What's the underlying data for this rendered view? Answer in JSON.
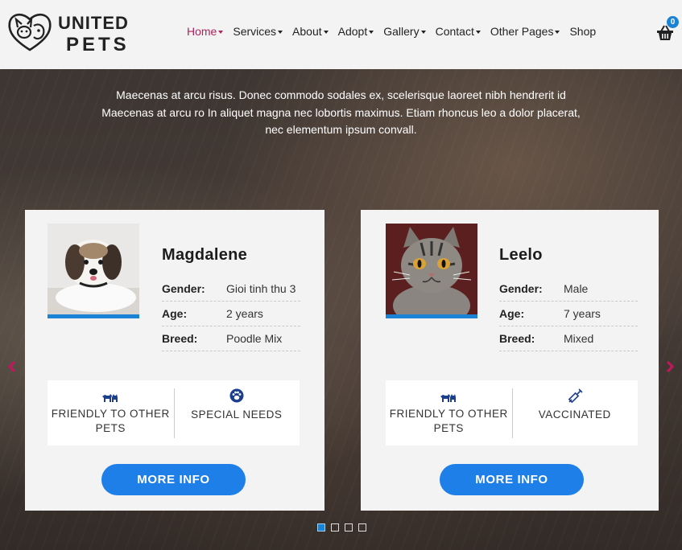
{
  "brand": {
    "line1": "UNITED",
    "line2": "PETS"
  },
  "nav": {
    "items": [
      {
        "label": "Home",
        "dropdown": true,
        "active": true
      },
      {
        "label": "Services",
        "dropdown": true
      },
      {
        "label": "About",
        "dropdown": true
      },
      {
        "label": "Adopt",
        "dropdown": true
      },
      {
        "label": "Gallery",
        "dropdown": true
      },
      {
        "label": "Contact",
        "dropdown": true
      },
      {
        "label": "Other Pages",
        "dropdown": true
      },
      {
        "label": "Shop",
        "dropdown": false
      }
    ],
    "cart_count": "0"
  },
  "hero": {
    "text_line1": "Maecenas at arcu risus. Donec commodo sodales ex, scelerisque laoreet nibh hendrerit id",
    "text_line2": "Maecenas at arcu ro In aliquet magna nec lobortis maximus. Etiam rhoncus leo a dolor placerat,",
    "text_line3": "nec elementum ipsum convall."
  },
  "pets": [
    {
      "name": "Magdalene",
      "gender_label": "Gender:",
      "gender": "Gioi tinh thu 3",
      "age_label": "Age:",
      "age": "2 years",
      "breed_label": "Breed:",
      "breed": "Poodle Mix",
      "feature1": "Friendly to other pets",
      "feature2": "Special needs",
      "button": "MORE INFO"
    },
    {
      "name": "Leelo",
      "gender_label": "Gender:",
      "gender": "Male",
      "age_label": "Age:",
      "age": "7 years",
      "breed_label": "Breed:",
      "breed": "Mixed",
      "feature1": "Friendly to other pets",
      "feature2": "Vaccinated",
      "button": "MORE INFO"
    }
  ],
  "carousel": {
    "active_page": 1,
    "page_count": 4
  },
  "colors": {
    "accent": "#1e7fe8",
    "nav_active": "#b0235f",
    "arrow": "#c2185b"
  }
}
